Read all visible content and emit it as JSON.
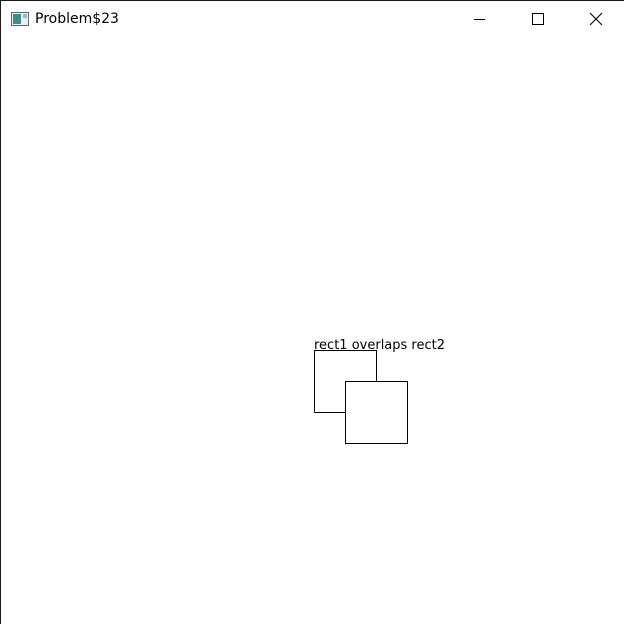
{
  "window": {
    "title": "Problem$23",
    "icon": "java-app-icon"
  },
  "controls": {
    "minimize": "minimize-icon",
    "maximize": "maximize-icon",
    "close": "close-icon"
  },
  "canvas": {
    "message": "rect1 overlaps rect2",
    "stroke_color": "#000000",
    "background_color": "#ffffff"
  }
}
